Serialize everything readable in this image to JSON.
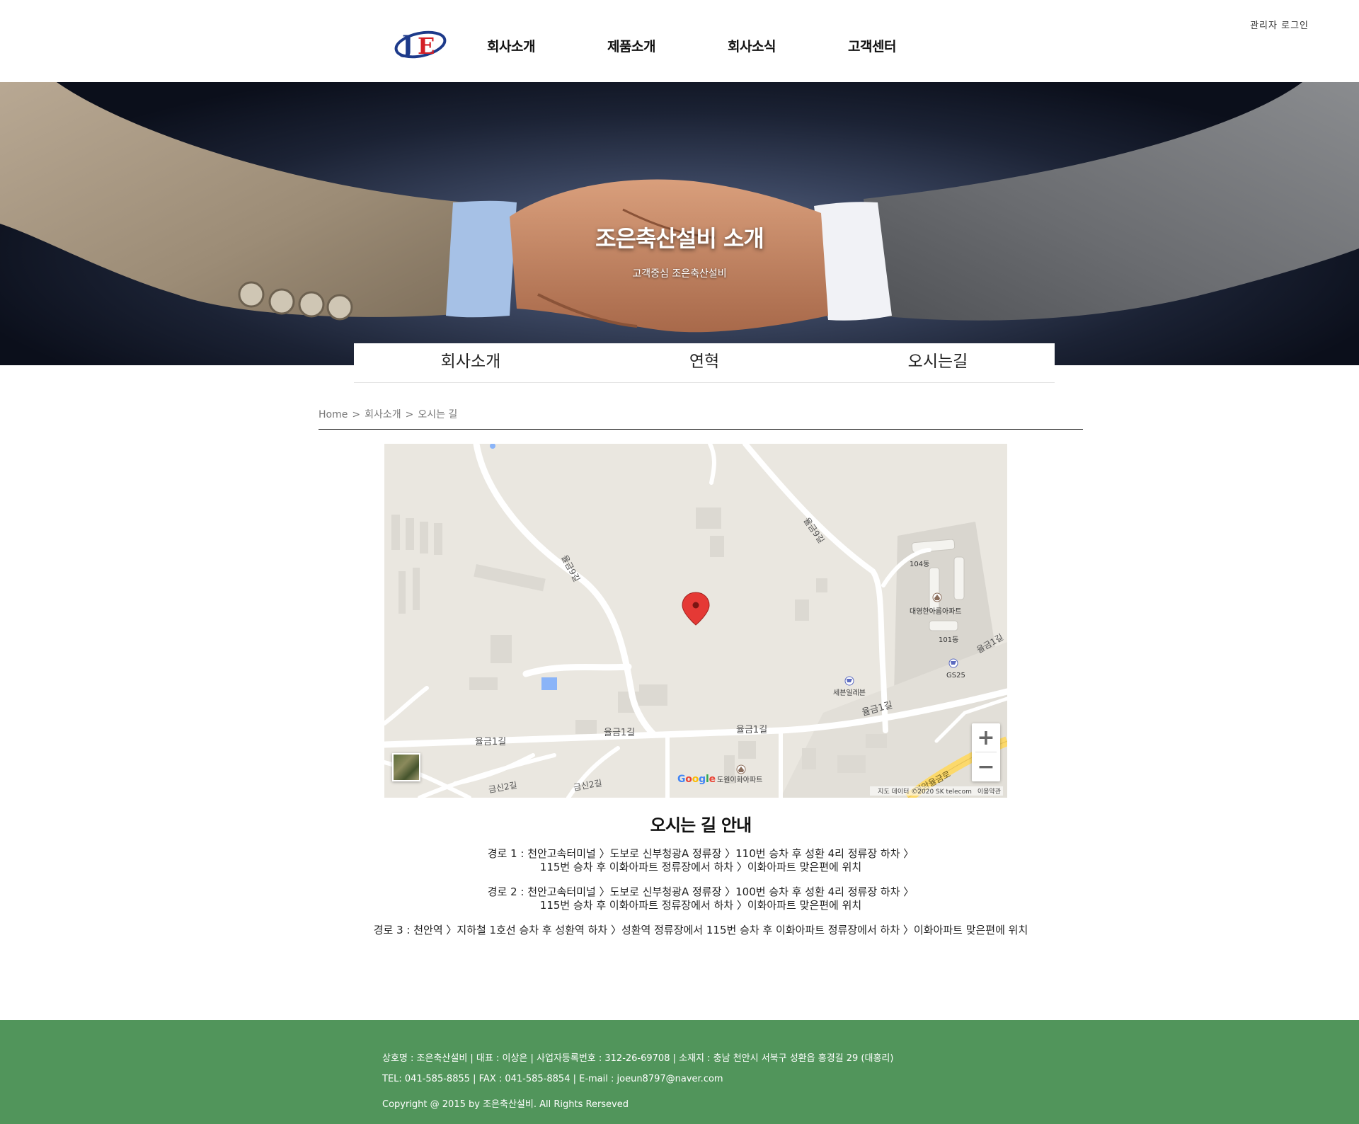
{
  "header": {
    "nav": [
      "회사소개",
      "제품소개",
      "회사소식",
      "고객센터"
    ],
    "admin_login": "관리자 로그인",
    "logo_letters": "JE"
  },
  "hero": {
    "title": "조은축산설비 소개",
    "subtitle": "고객중심 조은축산설비"
  },
  "subtabs": [
    "회사소개",
    "연혁",
    "오시는길"
  ],
  "breadcrumb": [
    "Home",
    "회사소개",
    "오시는 길"
  ],
  "breadcrumb_separator": ">",
  "map": {
    "labels": {
      "road_ul1": "율금1길",
      "road_ul1_b": "율금1길",
      "road_ul1_c": "율금1길",
      "road_ul1_d": "율금1길",
      "road_ul1_e": "율금1길",
      "road_ul9": "율금9길",
      "road_geum2": "금신2길",
      "road_geum2_b": "금신2길",
      "road_yeonam": "연암율금로",
      "apt_104": "104동",
      "apt_101": "101동",
      "apt_name": "대영한아름아파트",
      "gs25": "GS25",
      "seven": "세븐일레븐",
      "dowon": "도원이화아파트"
    },
    "google": "Google",
    "attribution": "지도 데이터 ©2020 SK telecom",
    "terms": "이용약관",
    "zoom_in": "+",
    "zoom_out": "−"
  },
  "directions": {
    "title": "오시는 길 안내",
    "routes": [
      [
        "경로 1 : 천안고속터미널 〉도보로 신부청광A 정류장 〉110번 승차 후 성환 4리 정류장 하차 〉",
        "115번 승차 후 이화아파트 정류장에서 하차 〉이화아파트 맞은편에 위치"
      ],
      [
        "경로 2 : 천안고속터미널 〉도보로 신부청광A 정류장 〉100번 승차 후 성환 4리 정류장 하차 〉",
        "115번 승차 후 이화아파트 정류장에서 하차 〉이화아파트 맞은편에 위치"
      ],
      [
        "경로 3 : 천안역 〉지하철 1호선 승차 후 성환역 하차 〉성환역 정류장에서 115번 승차 후 이화아파트 정류장에서 하차 〉이화아파트 맞은편에 위치"
      ]
    ]
  },
  "footer": {
    "line1": "상호명 : 조은축산설비 | 대표 : 이상은 | 사업자등록번호 : 312-26-69708 | 소재지 : 충남 천안시 서북구 성환읍 홍경길 29 (대홍리)",
    "line2": "TEL: 041-585-8855 | FAX : 041-585-8854 | E-mail : joeun8797@naver.com",
    "line3": "Copyright @ 2015 by 조은축산설비. All Rights Rerseved"
  },
  "colors": {
    "footer_bg": "#51955b",
    "logo_blue": "#1d3a8a",
    "logo_red": "#d41f26",
    "map_pin": "#e53935"
  }
}
